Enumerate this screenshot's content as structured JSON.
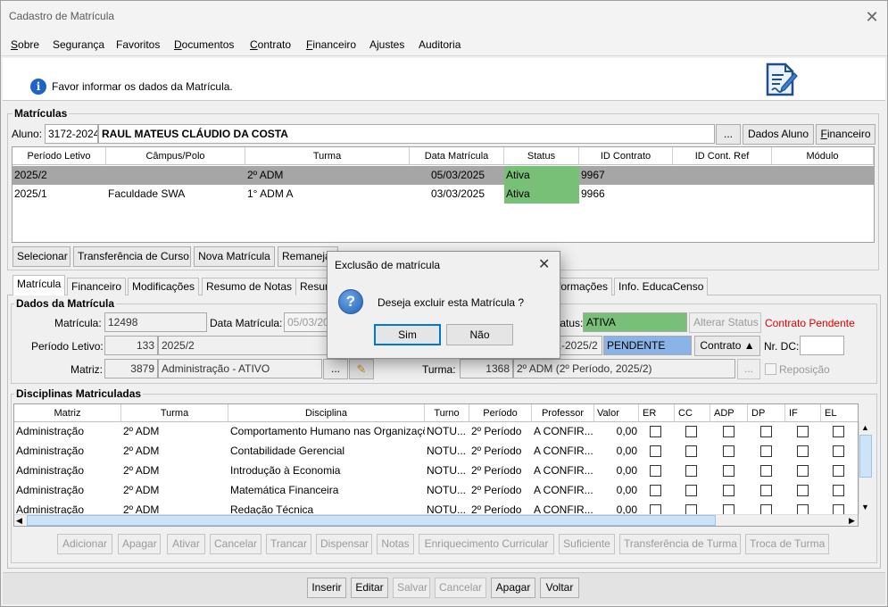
{
  "window": {
    "title": "Cadastro de Matrícula",
    "close": "✕"
  },
  "menu": [
    {
      "first": "S",
      "rest": "obre"
    },
    {
      "first": "",
      "rest": "Segurança"
    },
    {
      "first": "",
      "rest": "Favoritos"
    },
    {
      "first": "D",
      "rest": "ocumentos"
    },
    {
      "first": "C",
      "rest": "ontrato"
    },
    {
      "first": "F",
      "rest": "inanceiro"
    },
    {
      "first": "",
      "rest": "Ajustes"
    },
    {
      "first": "",
      "rest": "Auditoria"
    }
  ],
  "info": {
    "text": "Favor informar os dados da Matrícula."
  },
  "matriculas": {
    "title": "Matrículas",
    "aluno_label": "Aluno:",
    "aluno_code": "3172-2024",
    "aluno_name": "RAUL MATEUS CLÁUDIO DA COSTA",
    "ellipsis": "...",
    "dados_aluno": "Dados Aluno",
    "financeiro_first": "F",
    "financeiro_rest": "inanceiro",
    "columns": [
      "Período Letivo",
      "Câmpus/Polo",
      "Turma",
      "Data Matrícula",
      "Status",
      "ID Contrato",
      "ID Cont. Ref",
      "Módulo"
    ],
    "rows": [
      {
        "periodo": "2025/2",
        "campus": "",
        "turma": "2º ADM",
        "data": "05/03/2025",
        "status": "Ativa",
        "contrato": "9967",
        "ref": "",
        "modulo": ""
      },
      {
        "periodo": "2025/1",
        "campus": "Faculdade SWA",
        "turma": "1° ADM A",
        "data": "03/03/2025",
        "status": "Ativa",
        "contrato": "9966",
        "ref": "",
        "modulo": ""
      }
    ],
    "buttons": [
      "Selecionar",
      "Transferência de Curso",
      "Nova Matrícula",
      "Remaneja"
    ]
  },
  "tabs": [
    "Matrícula",
    "Financeiro",
    "Modificações",
    "Resumo de Notas",
    "Resum",
    "formações",
    "Info. EducaCenso"
  ],
  "dados": {
    "title": "Dados da Matrícula",
    "matricula_label": "Matrícula:",
    "matricula_value": "12498",
    "data_label": "Data Matrícula:",
    "data_value": "05/03/20",
    "status_label": "tatus:",
    "status_value": "ATIVA",
    "alterar_status": "Alterar Status",
    "contrato_pendente": "Contrato Pendente",
    "periodo_label": "Período Letivo:",
    "periodo_code": "133",
    "periodo_value": "2025/2",
    "contrato_ref": "X-2025/2",
    "contrato_status": "PENDENTE",
    "contrato_btn": "Contrato",
    "nrdc_label": "Nr. DC:",
    "matriz_label": "Matriz:",
    "matriz_code": "3879",
    "matriz_value": "Administração - ATIVO",
    "turma_label": "Turma:",
    "turma_code": "1368",
    "turma_value": "2º ADM (2º Período, 2025/2)",
    "reposicao": "Reposição"
  },
  "disciplinas": {
    "title": "Disciplinas Matriculadas",
    "columns": [
      "Matriz",
      "Turma",
      "Disciplina",
      "Turno",
      "Período",
      "Professor",
      "Valor",
      "ER",
      "CC",
      "ADP",
      "DP",
      "IF",
      "EL"
    ],
    "rows": [
      {
        "matriz": "Administração",
        "turma": "2º ADM",
        "disciplina": "Comportamento Humano nas Organizaçõ",
        "turno": "NOTU...",
        "periodo": "2º Período",
        "professor": "A CONFIR...",
        "valor": "0,00"
      },
      {
        "matriz": "Administração",
        "turma": "2º ADM",
        "disciplina": "Contabilidade Gerencial",
        "turno": "NOTU...",
        "periodo": "2º Período",
        "professor": "A CONFIR...",
        "valor": "0,00"
      },
      {
        "matriz": "Administração",
        "turma": "2º ADM",
        "disciplina": "Introdução à Economia",
        "turno": "NOTU...",
        "periodo": "2º Período",
        "professor": "A CONFIR...",
        "valor": "0,00"
      },
      {
        "matriz": "Administração",
        "turma": "2º ADM",
        "disciplina": "Matemática Financeira",
        "turno": "NOTU...",
        "periodo": "2º Período",
        "professor": "A CONFIR...",
        "valor": "0,00"
      },
      {
        "matriz": "Administração",
        "turma": "2º ADM",
        "disciplina": "Redação Técnica",
        "turno": "NOTU...",
        "periodo": "2º Período",
        "professor": "A CONFIR...",
        "valor": "0,00"
      }
    ],
    "actions": [
      "Adicionar",
      "Apagar",
      "Ativar",
      "Cancelar",
      "Trancar",
      "Dispensar",
      "Notas",
      "Enriquecimento Curricular",
      "Suficiente",
      "Transferência de Turma",
      "Troca de Turma"
    ]
  },
  "bottom": [
    "Inserir",
    "Editar",
    "Salvar",
    "Cancelar",
    "Apagar",
    "Voltar"
  ],
  "dialog": {
    "title": "Exclusão de matrícula",
    "close": "✕",
    "message": "Deseja excluir esta Matrícula ?",
    "icon": "?",
    "yes": "Sim",
    "no": "Não"
  },
  "colors": {
    "ativa": "#78c078",
    "pendente": "#8ab4e8",
    "selected_row": "#a6a6a6",
    "warning_red": "#e00000",
    "accent": "#0078d7"
  }
}
